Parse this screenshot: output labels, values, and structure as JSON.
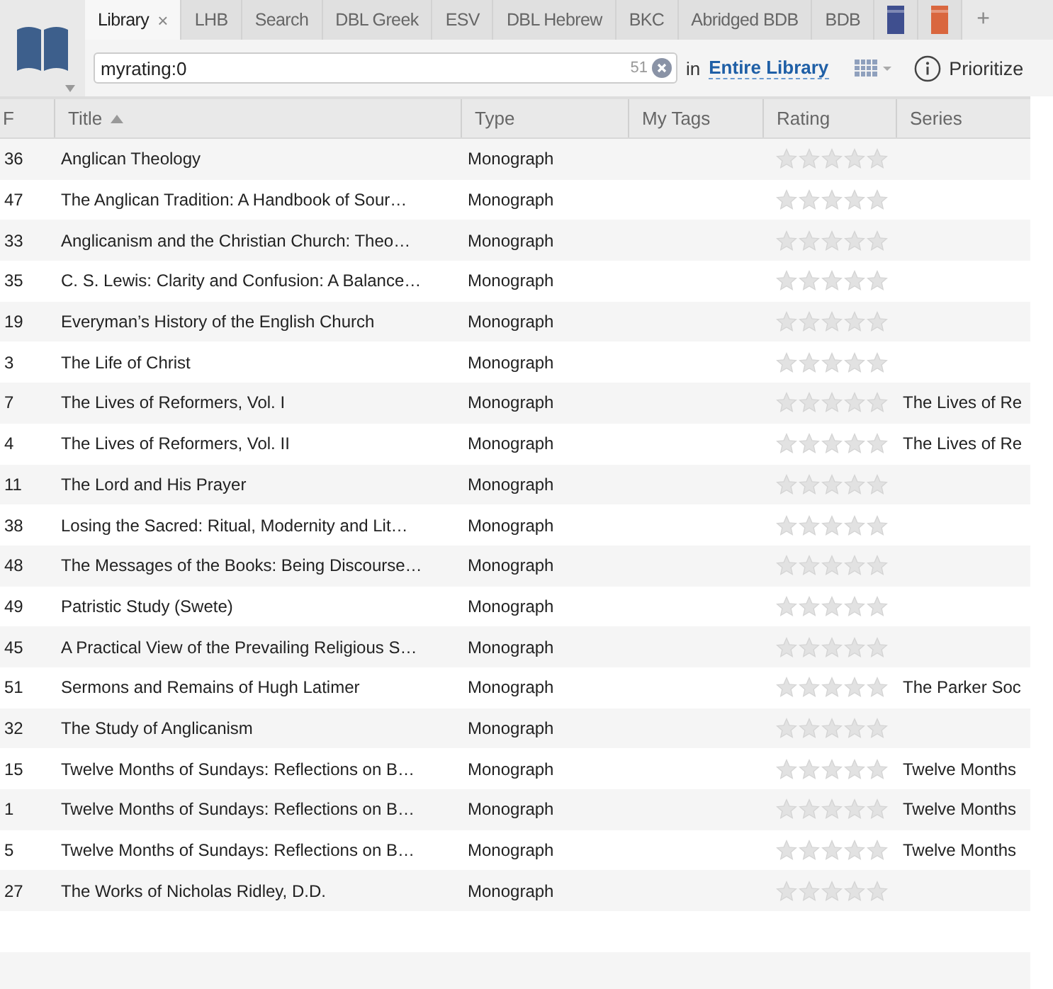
{
  "tabs": [
    {
      "kind": "text",
      "label": "Library",
      "selected": true,
      "close": "×"
    },
    {
      "kind": "text",
      "label": "LHB",
      "selected": false
    },
    {
      "kind": "text",
      "label": "Search",
      "selected": false
    },
    {
      "kind": "text",
      "label": "DBL Greek",
      "selected": false
    },
    {
      "kind": "text",
      "label": "ESV",
      "selected": false
    },
    {
      "kind": "text",
      "label": "DBL Hebrew",
      "selected": false
    },
    {
      "kind": "text",
      "label": "BKC",
      "selected": false
    },
    {
      "kind": "text",
      "label": "Abridged BDB",
      "selected": false
    },
    {
      "kind": "text",
      "label": "BDB",
      "selected": false
    },
    {
      "kind": "cover",
      "color": "#3f4f8f",
      "selected": false
    },
    {
      "kind": "cover",
      "color": "#d9673f",
      "selected": false
    },
    {
      "kind": "add",
      "label": "+"
    }
  ],
  "search": {
    "value": "myrating:0",
    "count": "51",
    "scope_prefix": "in",
    "scope": "Entire Library"
  },
  "prioritize": "Prioritize",
  "table": {
    "columns": [
      {
        "label": "F",
        "sorted": false
      },
      {
        "label": "Title",
        "sorted": true
      },
      {
        "label": "Type",
        "sorted": false
      },
      {
        "label": "My Tags",
        "sorted": false
      },
      {
        "label": "Rating",
        "sorted": false
      },
      {
        "label": "Series",
        "sorted": false
      }
    ],
    "rows": [
      {
        "f": "36",
        "title": "Anglican Theology",
        "type": "Monograph",
        "stars": 0,
        "series": ""
      },
      {
        "f": "47",
        "title": "The Anglican Tradition: A Handbook of Sour…",
        "type": "Monograph",
        "stars": 0,
        "series": ""
      },
      {
        "f": "33",
        "title": "Anglicanism and the Christian Church: Theo…",
        "type": "Monograph",
        "stars": 0,
        "series": ""
      },
      {
        "f": "35",
        "title": "C. S. Lewis: Clarity and Confusion: A Balance…",
        "type": "Monograph",
        "stars": 0,
        "series": ""
      },
      {
        "f": "19",
        "title": "Everyman’s History of the English Church",
        "type": "Monograph",
        "stars": 0,
        "series": ""
      },
      {
        "f": "3",
        "title": "The Life of Christ",
        "type": "Monograph",
        "stars": 0,
        "series": ""
      },
      {
        "f": "7",
        "title": "The Lives of Reformers, Vol. I",
        "type": "Monograph",
        "stars": 0,
        "series": "The Lives of Re"
      },
      {
        "f": "4",
        "title": "The Lives of Reformers, Vol. II",
        "type": "Monograph",
        "stars": 0,
        "series": "The Lives of Re"
      },
      {
        "f": "11",
        "title": "The Lord and His Prayer",
        "type": "Monograph",
        "stars": 0,
        "series": ""
      },
      {
        "f": "38",
        "title": "Losing the Sacred: Ritual, Modernity and Lit…",
        "type": "Monograph",
        "stars": 0,
        "series": ""
      },
      {
        "f": "48",
        "title": "The Messages of the Books: Being Discourse…",
        "type": "Monograph",
        "stars": 0,
        "series": ""
      },
      {
        "f": "49",
        "title": "Patristic Study (Swete)",
        "type": "Monograph",
        "stars": 0,
        "series": ""
      },
      {
        "f": "45",
        "title": "A Practical View of the Prevailing Religious S…",
        "type": "Monograph",
        "stars": 0,
        "series": ""
      },
      {
        "f": "51",
        "title": "Sermons and Remains of Hugh Latimer",
        "type": "Monograph",
        "stars": 0,
        "series": "The Parker Soc"
      },
      {
        "f": "32",
        "title": "The Study of Anglicanism",
        "type": "Monograph",
        "stars": 0,
        "series": ""
      },
      {
        "f": "15",
        "title": "Twelve Months of Sundays: Reflections on B…",
        "type": "Monograph",
        "stars": 0,
        "series": "Twelve Months"
      },
      {
        "f": "1",
        "title": "Twelve Months of Sundays: Reflections on B…",
        "type": "Monograph",
        "stars": 0,
        "series": "Twelve Months"
      },
      {
        "f": "5",
        "title": "Twelve Months of Sundays: Reflections on B…",
        "type": "Monograph",
        "stars": 0,
        "series": "Twelve Months"
      },
      {
        "f": "27",
        "title": "The Works of Nicholas Ridley, D.D.",
        "type": "Monograph",
        "stars": 0,
        "series": ""
      }
    ]
  }
}
